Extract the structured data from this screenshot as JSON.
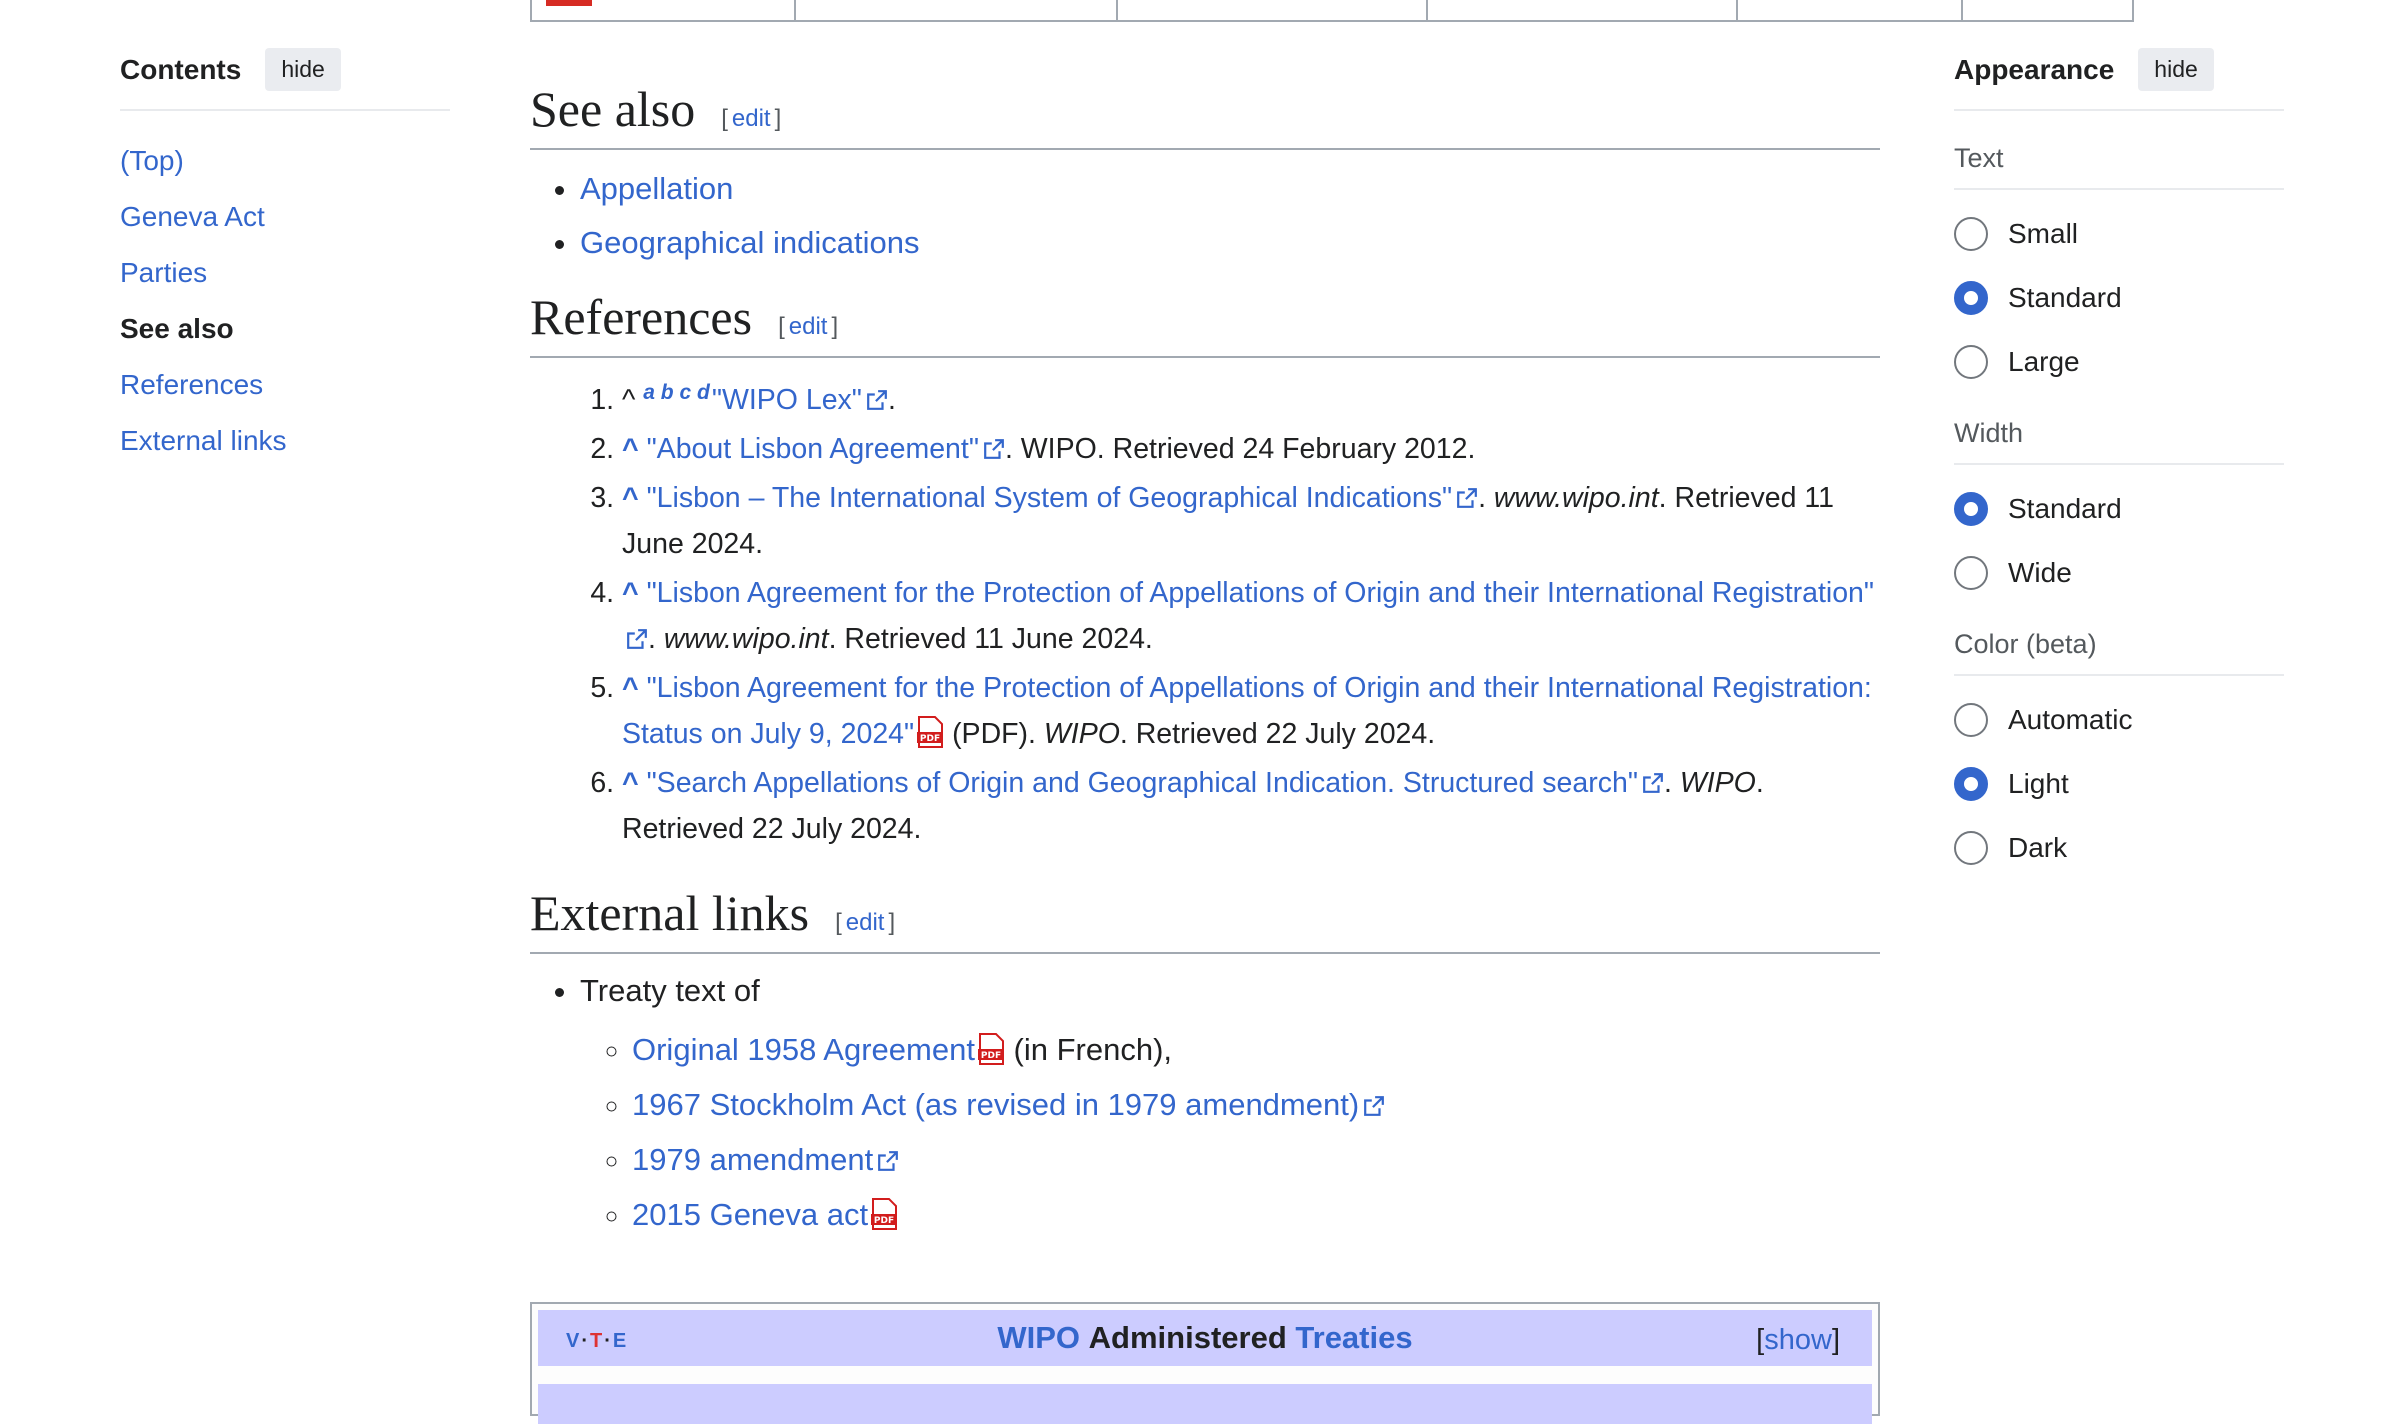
{
  "toc": {
    "title": "Contents",
    "hide_label": "hide",
    "items": [
      {
        "label": "(Top)"
      },
      {
        "label": "Geneva Act"
      },
      {
        "label": "Parties"
      },
      {
        "label": "See also"
      },
      {
        "label": "References"
      },
      {
        "label": "External links"
      }
    ]
  },
  "see_also": {
    "heading": "See also",
    "edit_label": "edit",
    "items": [
      "Appellation",
      "Geographical indications"
    ]
  },
  "references": {
    "heading": "References",
    "edit_label": "edit",
    "items": [
      {
        "backlinks": "a b c d",
        "link": "\"WIPO Lex\"",
        "after": "."
      },
      {
        "link": "\"About Lisbon Agreement\"",
        "after": ". WIPO. Retrieved 24 February 2012."
      },
      {
        "link": "\"Lisbon – The International System of Geographical Indications\"",
        "site": "www.wipo.int",
        "after": ". Retrieved 11 June 2024."
      },
      {
        "link": "\"Lisbon Agreement for the Protection of Appellations of Origin and their International Registration\"",
        "site": "www.wipo.int",
        "after": ". Retrieved 11 June 2024."
      },
      {
        "link": "\"Lisbon Agreement for the Protection of Appellations of Origin and their International Registration: Status on July 9, 2024\"",
        "format": "(PDF).",
        "site": "WIPO",
        "after": ". Retrieved 22 July 2024."
      },
      {
        "link": "\"Search Appellations of Origin and Geographical Indication. Structured search\"",
        "site": "WIPO",
        "after": ". Retrieved 22 July 2024."
      }
    ]
  },
  "external_links": {
    "heading": "External links",
    "edit_label": "edit",
    "intro": "Treaty text of",
    "items": [
      {
        "label": "Original 1958 Agreement",
        "after": " (in French),"
      },
      {
        "label": "1967 Stockholm Act (as revised in 1979 amendment)"
      },
      {
        "label": "1979 amendment"
      },
      {
        "label": "2015 Geneva act"
      }
    ]
  },
  "navbox": {
    "vte_v": "V",
    "vte_t": "T",
    "vte_e": "E",
    "title_link1": "WIPO",
    "title_middle": "Administered",
    "title_link2": "Treaties",
    "show_label": "show"
  },
  "appearance": {
    "title": "Appearance",
    "hide_label": "hide",
    "groups": [
      {
        "label": "Text",
        "options": [
          {
            "label": "Small",
            "selected": false
          },
          {
            "label": "Standard",
            "selected": true
          },
          {
            "label": "Large",
            "selected": false
          }
        ]
      },
      {
        "label": "Width",
        "options": [
          {
            "label": "Standard",
            "selected": true
          },
          {
            "label": "Wide",
            "selected": false
          }
        ]
      },
      {
        "label": "Color (beta)",
        "options": [
          {
            "label": "Automatic",
            "selected": false
          },
          {
            "label": "Light",
            "selected": true
          },
          {
            "label": "Dark",
            "selected": false
          }
        ]
      }
    ]
  },
  "colors": {
    "link": "#3366cc",
    "accent": "#3366cc",
    "navbox_title": "#ccccff",
    "pdf_red": "#d21d1d"
  }
}
